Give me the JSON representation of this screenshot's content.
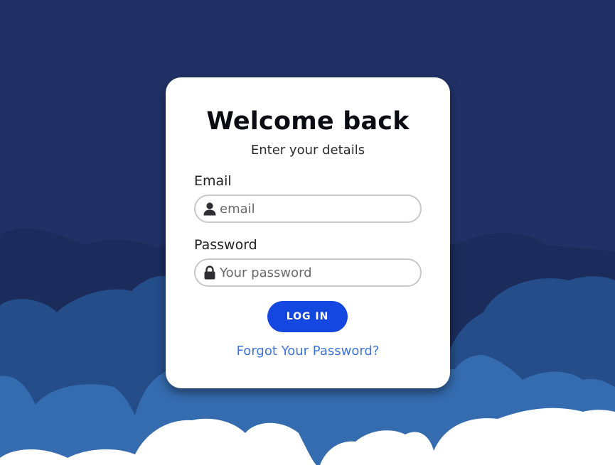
{
  "login": {
    "title": "Welcome back",
    "subtitle": "Enter your details",
    "email_label": "Email",
    "email_placeholder": "email",
    "password_label": "Password",
    "password_placeholder": "Your password",
    "login_button": "LOG IN",
    "forgot_link": "Forgot Your Password?"
  },
  "icons": {
    "email_field": "user-icon",
    "password_field": "lock-icon"
  },
  "colors": {
    "background": "#213166",
    "cloud_layer_1": "#1b2c5c",
    "cloud_layer_2": "#244d8a",
    "cloud_layer_3": "#356cb0",
    "cloud_front": "#ffffff",
    "button": "#1446e0",
    "link": "#3f73d8"
  }
}
